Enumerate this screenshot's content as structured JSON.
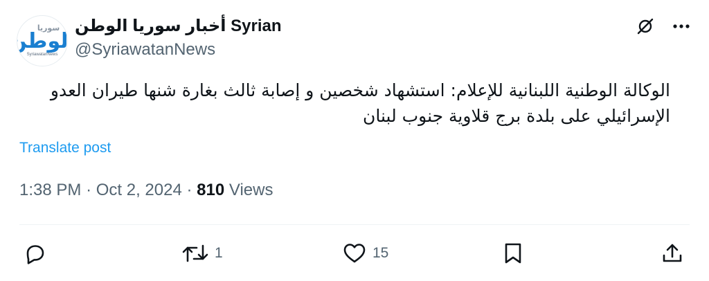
{
  "author": {
    "name": "أخبار سوريا الوطن Syrian",
    "handle": "@SyriawatanNews",
    "avatar": {
      "logo_small": "سوريا",
      "logo_big": "الوطن",
      "logo_tiny": "SyriawatanNews",
      "accent": "#1a7fd0"
    }
  },
  "top_icons": [
    "grok-icon",
    "more-icon"
  ],
  "post": {
    "text": "الوكالة الوطنية اللبنانية للإعلام: استشهاد شخصين و إصابة ثالث بغارة شنها طيران العدو الإسرائيلي على بلدة برج قلاوية جنوب لبنان",
    "translate_label": "Translate post"
  },
  "meta": {
    "time": "1:38 PM",
    "date": "Oct 2, 2024",
    "sep": "·",
    "views_count": "810",
    "views_label": "Views"
  },
  "actions": {
    "reply_count": "",
    "repost_count": "1",
    "like_count": "15"
  },
  "colors": {
    "text": "#0f1419",
    "secondary": "#536471",
    "link": "#1d9bf0",
    "divider": "#eff3f4"
  }
}
